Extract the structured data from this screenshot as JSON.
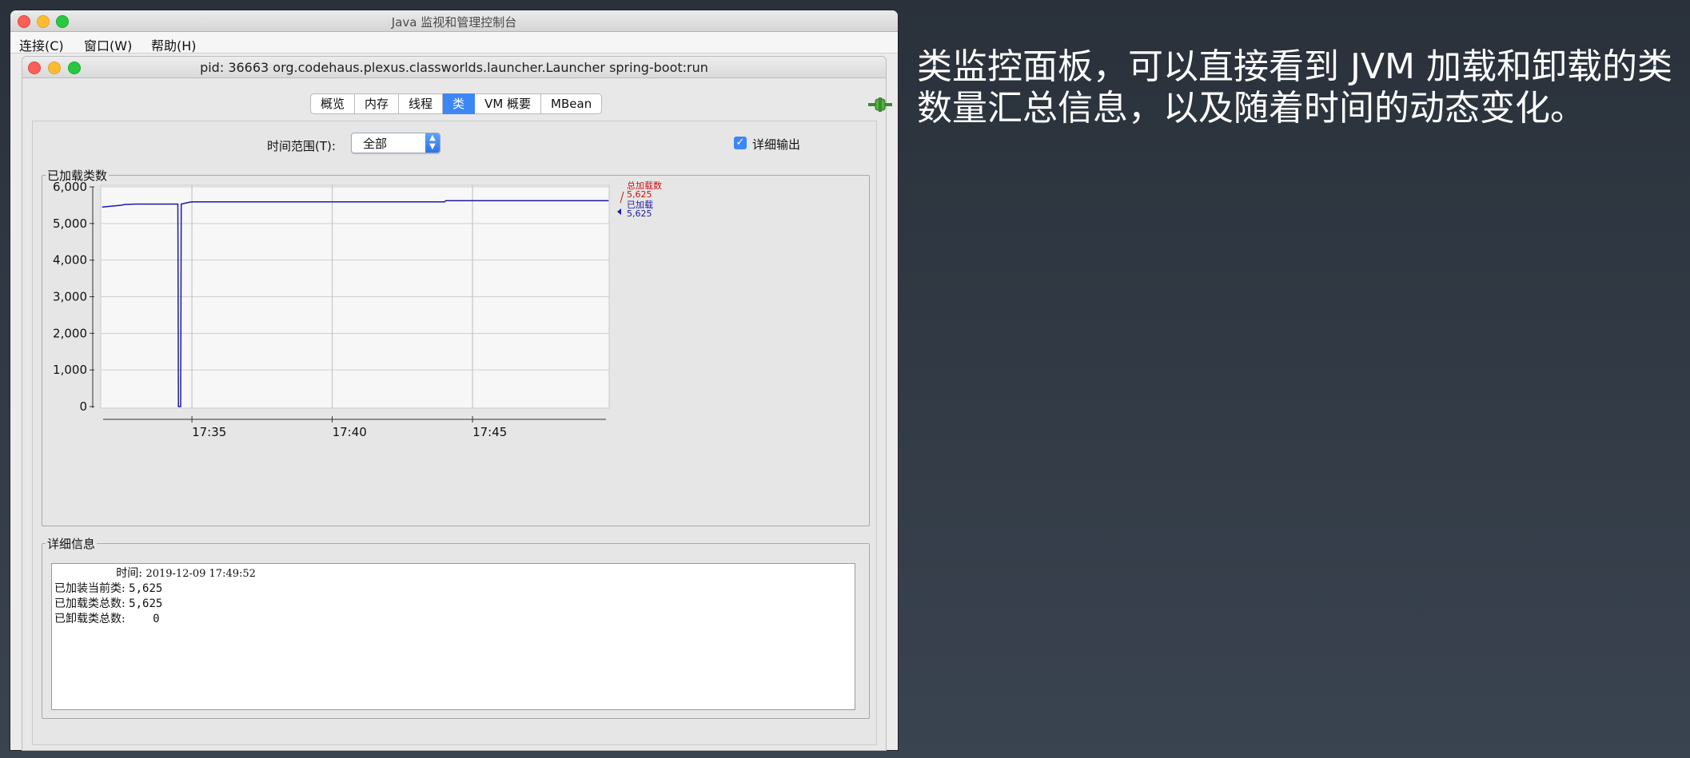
{
  "app": {
    "window_title": "Java 监视和管理控制台",
    "menu": [
      "连接(C)",
      "窗口(W)",
      "帮助(H)"
    ]
  },
  "inner": {
    "title": "pid: 36663 org.codehaus.plexus.classworlds.launcher.Launcher spring-boot:run",
    "tabs": [
      {
        "label": "概览",
        "active": false
      },
      {
        "label": "内存",
        "active": false
      },
      {
        "label": "线程",
        "active": false
      },
      {
        "label": "类",
        "active": true
      },
      {
        "label": "VM 概要",
        "active": false
      },
      {
        "label": "MBean",
        "active": false
      }
    ],
    "time_range_label": "时间范围(T):",
    "time_range_value": "全部",
    "verbose_label": "详细输出",
    "verbose_checked": true,
    "chart_group_label": "已加载类数",
    "details_group_label": "详细信息",
    "details": {
      "time_label": "时间:",
      "time_value": "2019-12-09 17:49:52",
      "current_label": "已加装当前类:",
      "current_value": "5,625",
      "total_loaded_label": "已加载类总数:",
      "total_loaded_value": "5,625",
      "total_unloaded_label": "已卸载类总数:",
      "total_unloaded_value": "0"
    }
  },
  "chart_data": {
    "type": "line",
    "ylabel": "",
    "xlabel": "",
    "ylim": [
      0,
      6000
    ],
    "yticks": [
      "0",
      "1,000",
      "2,000",
      "3,000",
      "4,000",
      "5,000",
      "6,000"
    ],
    "xticks": [
      {
        "t": 35,
        "label": "17:35"
      },
      {
        "t": 40,
        "label": "17:40"
      },
      {
        "t": 45,
        "label": "17:45"
      }
    ],
    "xlim": [
      31.75,
      49.87
    ],
    "grid": true,
    "series": [
      {
        "name": "已加载",
        "color": "#1a1aa6",
        "points": [
          [
            31.8,
            5450
          ],
          [
            32.1,
            5470
          ],
          [
            32.5,
            5500
          ],
          [
            32.6,
            5520
          ],
          [
            33.0,
            5530
          ],
          [
            34.5,
            5530
          ],
          [
            34.52,
            0
          ],
          [
            34.6,
            0
          ],
          [
            34.62,
            5530
          ],
          [
            34.9,
            5580
          ],
          [
            35.0,
            5590
          ],
          [
            44.0,
            5590
          ],
          [
            44.05,
            5625
          ],
          [
            49.85,
            5625
          ]
        ]
      },
      {
        "name": "",
        "color": "#cc1111",
        "points": []
      }
    ],
    "legend": [
      {
        "label": "总加载数",
        "value": "5,625",
        "color": "#cc1111"
      },
      {
        "label": "已加载",
        "value": "5,625",
        "color": "#1a1aa6"
      }
    ]
  },
  "annotation": "类监控面板，可以直接看到 JVM 加载和卸载的类数量汇总信息，以及随着时间的动态变化。"
}
